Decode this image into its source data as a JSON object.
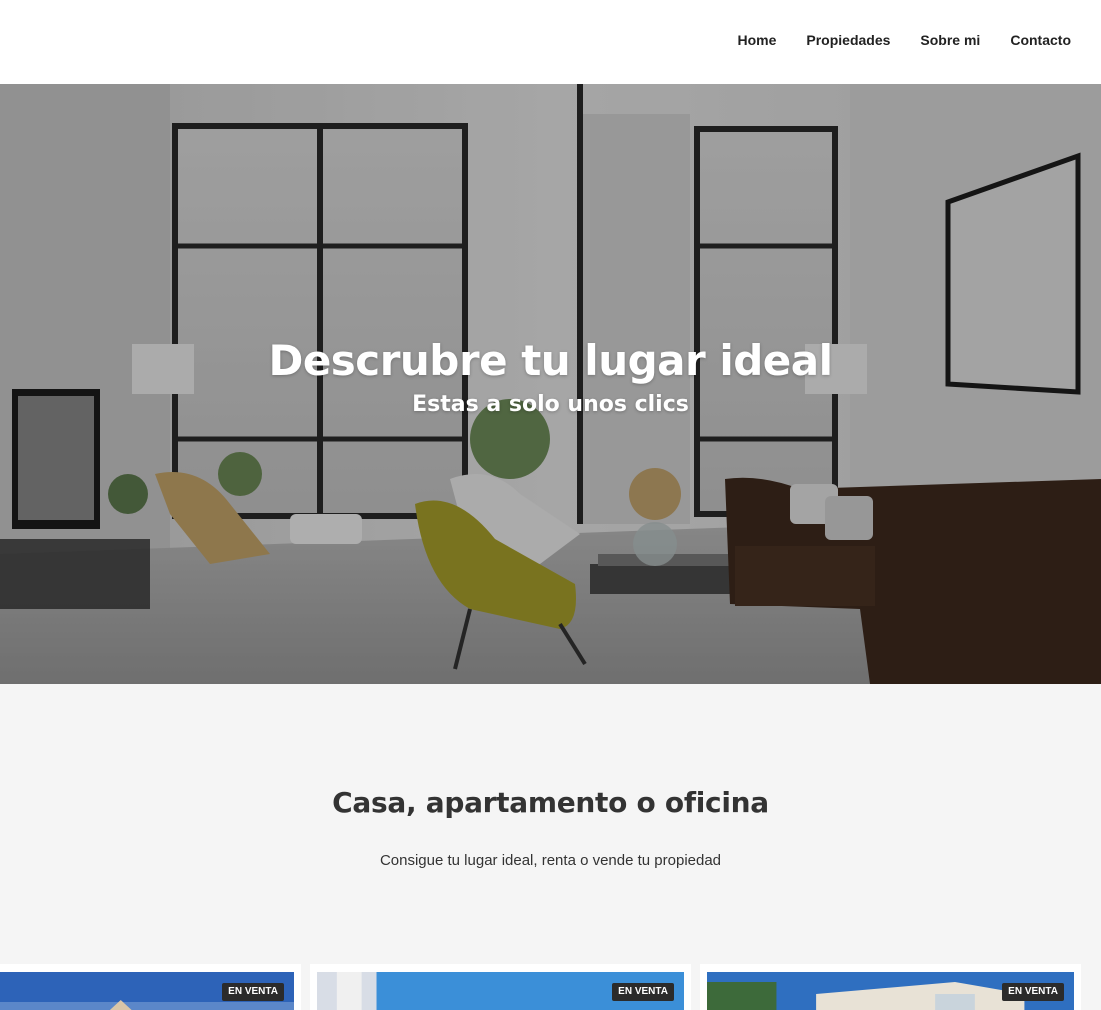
{
  "nav": {
    "items": [
      {
        "label": "Home"
      },
      {
        "label": "Propiedades"
      },
      {
        "label": "Sobre mi"
      },
      {
        "label": "Contacto"
      }
    ]
  },
  "hero": {
    "title": "Descrubre tu lugar ideal",
    "subtitle": "Estas a solo unos clics"
  },
  "section": {
    "title": "Casa, apartamento o oficina",
    "text": "Consigue tu lugar ideal, renta o vende tu propiedad"
  },
  "listings": [
    {
      "badge": "EN VENTA"
    },
    {
      "badge": "EN VENTA"
    },
    {
      "badge": "EN VENTA"
    }
  ]
}
